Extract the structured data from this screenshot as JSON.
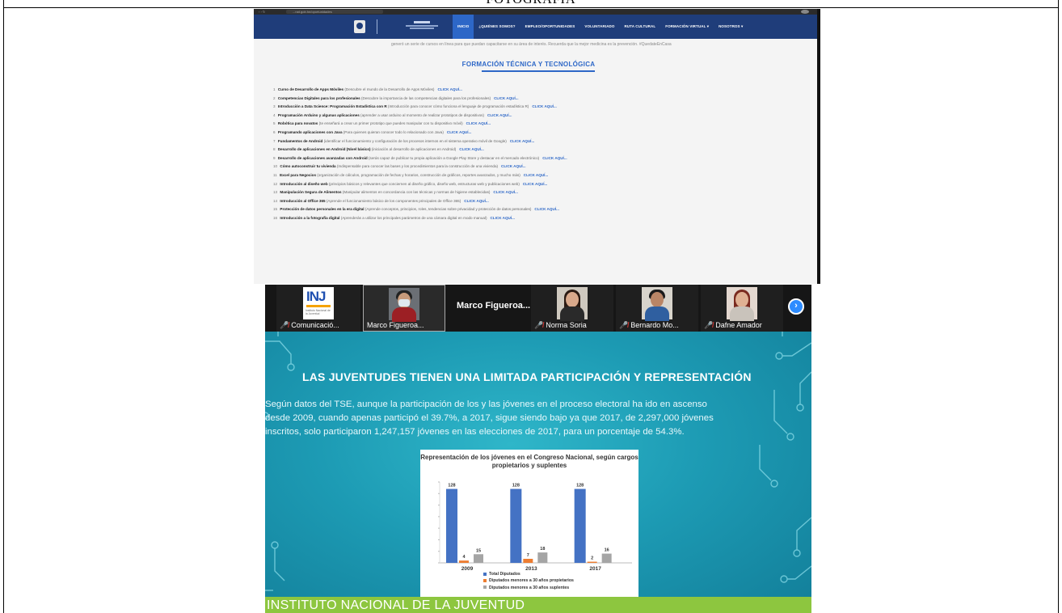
{
  "document": {
    "header_text": "FOTOGRAFIA"
  },
  "website": {
    "browser": {
      "url": "...nat.gob.hn/oportunidades"
    },
    "nav": {
      "items": [
        {
          "label": "INICIO",
          "active": true
        },
        {
          "label": "¿QUIÉNES SOMOS?",
          "active": false
        },
        {
          "label": "EMPLEO/OPORTUNIDADES",
          "active": false
        },
        {
          "label": "VOLUNTARIADO",
          "active": false
        },
        {
          "label": "RUTA CULTURAL",
          "active": false
        },
        {
          "label": "FORMACIÓN VIRTUAL ▾",
          "active": false
        },
        {
          "label": "NOSOTROS ▾",
          "active": false
        }
      ]
    },
    "intro_text": "generó un serie de cursos en línea para que puedan capacitarse en su área de interés. Recuerda que la mejor medicina es la prevención. #QuedateEnCasa",
    "section_title": "FORMACIÓN TÉCNICA Y TECNOLÓGICA",
    "link_label": "CLICK AQUÍ...",
    "courses": [
      {
        "num": "1",
        "name": "Curso de Desarrollo de Apps Móviles",
        "desc": "(Descubre el mundo de la Desarrollo de Apps Móviles)"
      },
      {
        "num": "2",
        "name": "Competencias Digitales para los profesionales",
        "desc": "(Descubre la importancia de las competencias digitales para los profesionales)"
      },
      {
        "num": "3",
        "name": "Introducción a Data Science: Programación Estadística con R",
        "desc": "(Introducción para conocer cómo funciona el lenguaje de programación estadística R)"
      },
      {
        "num": "4",
        "name": "Programación Arduino y algunas aplicaciones",
        "desc": "(aprender a usar arduino al momento de realizar prototipos de dispositivos)"
      },
      {
        "num": "5",
        "name": "Robótica para novatos",
        "desc": "(te enseñará a crear un primer prototipo que puedes manipular con tu dispositivo móvil)"
      },
      {
        "num": "6",
        "name": "Programando aplicaciones con Java",
        "desc": "(Para quienes quieran conocer todo lo relacionado con Java)"
      },
      {
        "num": "7",
        "name": "Fundamentos de Android",
        "desc": "(identificar el funcionamiento y configuración de los procesos internos en el sistema operativo móvil de Google)"
      },
      {
        "num": "8",
        "name": "Desarrollo de aplicaciones en Android (Nivel básico)",
        "desc": "(iniciación al desarrollo de aplicaciones en Android)"
      },
      {
        "num": "9",
        "name": "Desarrollo de aplicaciones avanzadas con Android",
        "desc": "(serás capaz de publicar tu propia aplicación a Google Play Store y destacar en el mercado electrónico)"
      },
      {
        "num": "10",
        "name": "Cómo autoconstruir tu vivienda",
        "desc": "(Indispensable para conocer las bases y los procedimientos para la construcción de una vivienda)"
      },
      {
        "num": "11",
        "name": "Excel para Negocios",
        "desc": "(organización de cálculos, programación de fechas y horarios, construcción de gráficos, reportes avanzados, y mucho más)"
      },
      {
        "num": "12",
        "name": "Introducción al diseño web",
        "desc": "(principios básicos y relevantes que conciernen al diseño gráfico, diseño web, estructuras web y publicaciones web)"
      },
      {
        "num": "13",
        "name": "Manipulación Segura de Alimentos",
        "desc": "(Manipular alimentos en concordancia con las técnicas y normas de higiene establecidas)"
      },
      {
        "num": "14",
        "name": "Introducción al Office 365",
        "desc": "(Aprende el funcionamiento básico de los componentes principales de Office 365)"
      },
      {
        "num": "15",
        "name": "Protección de datos personales en la era digital",
        "desc": "(Aprende conceptos, principios, roles, tendencias sobre privacidad y protección de datos personales)"
      },
      {
        "num": "16",
        "name": "Introducción a la fotografía digital",
        "desc": "(Aprenderás a utilizar los principales parámetros de una cámara digital en modo manual)"
      }
    ]
  },
  "meeting": {
    "participants": [
      {
        "name": "Comunicació...",
        "muted": true,
        "kind": "logo"
      },
      {
        "name": "Marco Figueroa...",
        "muted": false,
        "kind": "person",
        "speaking": true
      },
      {
        "name": "Norma Soria",
        "muted": true,
        "kind": "person"
      },
      {
        "name": "Bernardo Mo...",
        "muted": true,
        "kind": "person"
      },
      {
        "name": "Dafne Amador",
        "muted": true,
        "kind": "person"
      }
    ],
    "name_only_tile": "Marco  Figueroa...",
    "logo_text": {
      "main": "INJ",
      "sub": "Instituto Nacional de la Juventud"
    },
    "next_icon": "chevron-right-icon",
    "slide": {
      "title": "LAS JUVENTUDES TIENEN UNA LIMITADA PARTICIPACIÓN Y REPRESENTACIÓN",
      "body": "Según datos del TSE, aunque la participación de los y las jóvenes en el proceso electoral ha ido en ascenso desde 2009, cuando apenas participó el 39.7%, a 2017, sigue siendo bajo ya que 2017, de 2,297,000 jóvenes inscritos, solo participaron 1,247,157 jóvenes en las elecciones de 2017, para un porcentaje de 54.3%.",
      "footer": "INSTITUTO NACIONAL DE LA JUVENTUD"
    }
  },
  "chart_data": {
    "type": "bar",
    "title": "Representación de los jóvenes en el Congreso Nacional, según cargos propietarios y suplentes",
    "categories": [
      "2009",
      "2013",
      "2017"
    ],
    "series": [
      {
        "name": "Total Diputados",
        "values": [
          128,
          128,
          128
        ],
        "color": "#4472c4"
      },
      {
        "name": "Diputados menores a 30 años propietarios",
        "values": [
          4,
          7,
          2
        ],
        "color": "#ed7d31"
      },
      {
        "name": "Diputados menores a 30 años suplentes",
        "values": [
          15,
          18,
          16
        ],
        "color": "#a5a5a5"
      }
    ],
    "ylim": [
      0,
      140
    ],
    "legend": "bottom"
  },
  "colors": {
    "site_nav": "#1f3d7a",
    "site_accent": "#2d67c7",
    "slide_teal": "#1d9bb4",
    "footer_green": "#8dc63f",
    "zoom_blue": "#2d8cff",
    "muted_red": "#e53935"
  }
}
